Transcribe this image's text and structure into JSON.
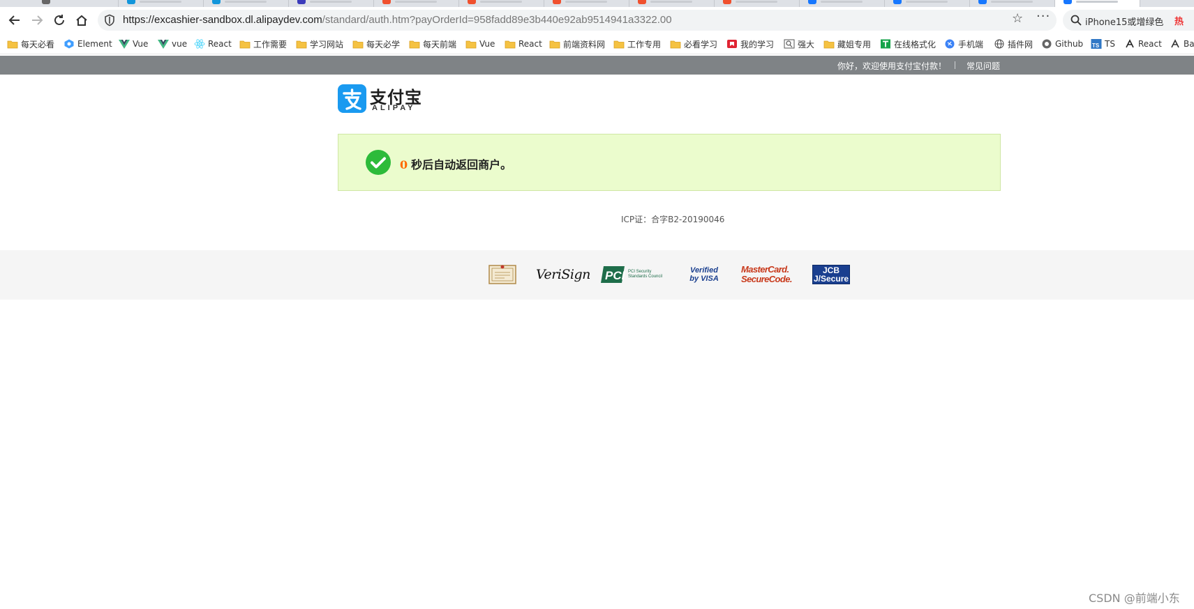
{
  "browser": {
    "url_host": "https://excashier-sandbox.dl.alipaydev.com",
    "url_path": "/standard/auth.htm?payOrderId=958fadd89e3b440e92ab9514941a3322.00",
    "search_text": "iPhone15或增绿色",
    "search_hot_label": "热"
  },
  "bookmarks": [
    {
      "label": "每天必看",
      "icon": "folder-icon"
    },
    {
      "label": "Element",
      "icon": "element-icon"
    },
    {
      "label": "Vue",
      "icon": "vue-icon"
    },
    {
      "label": "vue",
      "icon": "vue-icon"
    },
    {
      "label": "React",
      "icon": "react-icon"
    },
    {
      "label": "工作需要",
      "icon": "folder-icon"
    },
    {
      "label": "学习网站",
      "icon": "folder-icon"
    },
    {
      "label": "每天必学",
      "icon": "folder-icon"
    },
    {
      "label": "每天前端",
      "icon": "folder-icon"
    },
    {
      "label": "Vue",
      "icon": "folder-icon"
    },
    {
      "label": "React",
      "icon": "folder-icon"
    },
    {
      "label": "前端资料网",
      "icon": "folder-icon"
    },
    {
      "label": "工作专用",
      "icon": "folder-icon"
    },
    {
      "label": "必看学习",
      "icon": "folder-icon"
    },
    {
      "label": "我的学习",
      "icon": "bookmark-red-icon"
    },
    {
      "label": "强大",
      "icon": "search-box-icon"
    },
    {
      "label": "藏姐专用",
      "icon": "folder-icon"
    },
    {
      "label": "在线格式化",
      "icon": "format-icon"
    },
    {
      "label": "手机端",
      "icon": "mobile-icon"
    },
    {
      "label": "插件网",
      "icon": "globe-icon"
    },
    {
      "label": "Github",
      "icon": "github-icon"
    },
    {
      "label": "TS",
      "icon": "ts-icon"
    },
    {
      "label": "React",
      "icon": "react-dark-icon"
    },
    {
      "label": "Ba",
      "icon": "ba-icon"
    }
  ],
  "topbar": {
    "welcome": "你好，欢迎使用支付宝付款！",
    "faq": "常见问题"
  },
  "logo": {
    "name": "支付宝",
    "sub": "ALIPAY"
  },
  "notice": {
    "countdown": "0",
    "message": "秒后自动返回商户。"
  },
  "footer": {
    "icp": "ICP证：合字B2-20190046",
    "badges": [
      "VeriSign",
      "PCI Security Standards Council",
      "Verified by VISA",
      "MasterCard. SecureCode.",
      "JCB J/Secure"
    ]
  },
  "watermark": "CSDN @前端小东",
  "colors": {
    "topbar": "#7f8386",
    "notice_bg": "#ebfccd",
    "countdown": "#ff6a00",
    "check": "#2dbb3a",
    "alipay_blue": "#1a9af0"
  }
}
